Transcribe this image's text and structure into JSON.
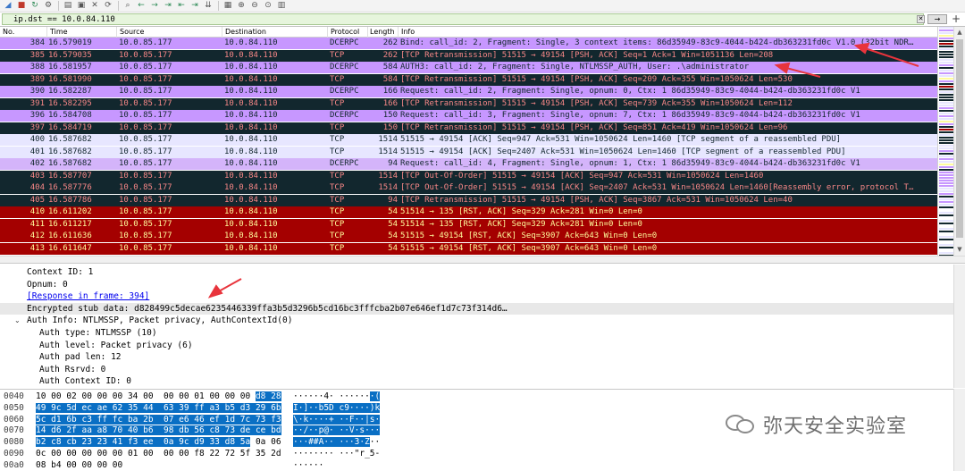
{
  "toolbar": {
    "icons": [
      "shark-fin-start-icon",
      "stop-icon",
      "restart-icon",
      "options-gear-icon",
      "open-file-icon",
      "save-file-icon",
      "close-file-icon",
      "reload-icon",
      "find-icon",
      "go-back-icon",
      "go-forward-icon",
      "jump-to-icon",
      "go-first-icon",
      "go-last-icon",
      "autoscroll-icon",
      "colorize-icon",
      "zoom-in-icon",
      "zoom-out-icon",
      "zoom-normal-icon",
      "resize-columns-icon"
    ]
  },
  "filter": {
    "value": "ip.dst == 10.0.84.110",
    "apply_label": "→"
  },
  "columns": [
    "No.",
    "Time",
    "Source",
    "Destination",
    "Protocol",
    "Length",
    "Info"
  ],
  "packets": [
    {
      "no": "384",
      "time": "16.579019",
      "src": "10.0.85.177",
      "dst": "10.0.84.110",
      "proto": "DCERPC",
      "len": "262",
      "info": "Bind: call_id: 2, Fragment: Single, 3 context items: 86d35949-83c9-4044-b424-db363231fd0c V1.0 (32bit NDR…",
      "style": "dcerpc"
    },
    {
      "no": "385",
      "time": "16.579035",
      "src": "10.0.85.177",
      "dst": "10.0.84.110",
      "proto": "TCP",
      "len": "262",
      "info": "[TCP Retransmission] 51515 → 49154 [PSH, ACK] Seq=1 Ack=1 Win=1051136 Len=208",
      "style": "tcpdark"
    },
    {
      "no": "388",
      "time": "16.581957",
      "src": "10.0.85.177",
      "dst": "10.0.84.110",
      "proto": "DCERPC",
      "len": "584",
      "info": "AUTH3: call_id: 2, Fragment: Single, NTLMSSP_AUTH, User: .\\administrator",
      "style": "dcerpc"
    },
    {
      "no": "389",
      "time": "16.581990",
      "src": "10.0.85.177",
      "dst": "10.0.84.110",
      "proto": "TCP",
      "len": "584",
      "info": "[TCP Retransmission] 51515 → 49154 [PSH, ACK] Seq=209 Ack=355 Win=1050624 Len=530",
      "style": "tcpdark"
    },
    {
      "no": "390",
      "time": "16.582287",
      "src": "10.0.85.177",
      "dst": "10.0.84.110",
      "proto": "DCERPC",
      "len": "166",
      "info": "Request: call_id: 2, Fragment: Single, opnum: 0, Ctx: 1 86d35949-83c9-4044-b424-db363231fd0c V1",
      "style": "dcerpc"
    },
    {
      "no": "391",
      "time": "16.582295",
      "src": "10.0.85.177",
      "dst": "10.0.84.110",
      "proto": "TCP",
      "len": "166",
      "info": "[TCP Retransmission] 51515 → 49154 [PSH, ACK] Seq=739 Ack=355 Win=1050624 Len=112",
      "style": "tcpdark"
    },
    {
      "no": "396",
      "time": "16.584708",
      "src": "10.0.85.177",
      "dst": "10.0.84.110",
      "proto": "DCERPC",
      "len": "150",
      "info": "Request: call_id: 3, Fragment: Single, opnum: 7, Ctx: 1 86d35949-83c9-4044-b424-db363231fd0c V1",
      "style": "dcerpc"
    },
    {
      "no": "397",
      "time": "16.584719",
      "src": "10.0.85.177",
      "dst": "10.0.84.110",
      "proto": "TCP",
      "len": "150",
      "info": "[TCP Retransmission] 51515 → 49154 [PSH, ACK] Seq=851 Ack=419 Win=1050624 Len=96",
      "style": "tcpdark"
    },
    {
      "no": "400",
      "time": "16.587682",
      "src": "10.0.85.177",
      "dst": "10.0.84.110",
      "proto": "TCP",
      "len": "1514",
      "info": "51515 → 49154 [ACK] Seq=947 Ack=531 Win=1050624 Len=1460 [TCP segment of a reassembled PDU]",
      "style": "tcplight"
    },
    {
      "no": "401",
      "time": "16.587682",
      "src": "10.0.85.177",
      "dst": "10.0.84.110",
      "proto": "TCP",
      "len": "1514",
      "info": "51515 → 49154 [ACK] Seq=2407 Ack=531 Win=1050624 Len=1460 [TCP segment of a reassembled PDU]",
      "style": "tcplight"
    },
    {
      "no": "402",
      "time": "16.587682",
      "src": "10.0.85.177",
      "dst": "10.0.84.110",
      "proto": "DCERPC",
      "len": "94",
      "info": "Request: call_id: 4, Fragment: Single, opnum: 1, Ctx: 1 86d35949-83c9-4044-b424-db363231fd0c V1",
      "style": "dcerpc-sel"
    },
    {
      "no": "403",
      "time": "16.587707",
      "src": "10.0.85.177",
      "dst": "10.0.84.110",
      "proto": "TCP",
      "len": "1514",
      "info": "[TCP Out-Of-Order] 51515 → 49154 [ACK] Seq=947 Ack=531 Win=1050624 Len=1460",
      "style": "tcpdark"
    },
    {
      "no": "404",
      "time": "16.587776",
      "src": "10.0.85.177",
      "dst": "10.0.84.110",
      "proto": "TCP",
      "len": "1514",
      "info": "[TCP Out-Of-Order] 51515 → 49154 [ACK] Seq=2407 Ack=531 Win=1050624 Len=1460[Reassembly error, protocol T…",
      "style": "tcpdark"
    },
    {
      "no": "405",
      "time": "16.587786",
      "src": "10.0.85.177",
      "dst": "10.0.84.110",
      "proto": "TCP",
      "len": "94",
      "info": "[TCP Retransmission] 51515 → 49154 [PSH, ACK] Seq=3867 Ack=531 Win=1050624 Len=40",
      "style": "tcpdark"
    },
    {
      "no": "410",
      "time": "16.611202",
      "src": "10.0.85.177",
      "dst": "10.0.84.110",
      "proto": "TCP",
      "len": "54",
      "info": "51514 → 135 [RST, ACK] Seq=329 Ack=281 Win=0 Len=0",
      "style": "rst"
    },
    {
      "no": "411",
      "time": "16.611217",
      "src": "10.0.85.177",
      "dst": "10.0.84.110",
      "proto": "TCP",
      "len": "54",
      "info": "51514 → 135 [RST, ACK] Seq=329 Ack=281 Win=0 Len=0",
      "style": "rst"
    },
    {
      "no": "412",
      "time": "16.611636",
      "src": "10.0.85.177",
      "dst": "10.0.84.110",
      "proto": "TCP",
      "len": "54",
      "info": "51515 → 49154 [RST, ACK] Seq=3907 Ack=643 Win=0 Len=0",
      "style": "rst"
    },
    {
      "no": "413",
      "time": "16.611647",
      "src": "10.0.85.177",
      "dst": "10.0.84.110",
      "proto": "TCP",
      "len": "54",
      "info": "51515 → 49154 [RST, ACK] Seq=3907 Ack=643 Win=0 Len=0",
      "style": "rst"
    }
  ],
  "details": [
    {
      "text": "Context ID: 1",
      "indent": 1,
      "kind": "plain"
    },
    {
      "text": "Opnum: 0",
      "indent": 1,
      "kind": "plain"
    },
    {
      "text": "[Response in frame: 394]",
      "indent": 1,
      "kind": "link"
    },
    {
      "text": "Encrypted stub data: d828499c5decae6235446339ffa3b5d3296b5cd16bc3fffcba2b07e646ef1d7c73f314d6…",
      "indent": 1,
      "kind": "selected"
    },
    {
      "text": "Auth Info: NTLMSSP, Packet privacy, AuthContextId(0)",
      "indent": 1,
      "kind": "expanded"
    },
    {
      "text": "Auth type: NTLMSSP (10)",
      "indent": 2,
      "kind": "plain"
    },
    {
      "text": "Auth level: Packet privacy (6)",
      "indent": 2,
      "kind": "plain"
    },
    {
      "text": "Auth pad len: 12",
      "indent": 2,
      "kind": "plain"
    },
    {
      "text": "Auth Rsrvd: 0",
      "indent": 2,
      "kind": "plain"
    },
    {
      "text": "Auth Context ID: 0",
      "indent": 2,
      "kind": "plain"
    }
  ],
  "bytes": [
    {
      "offset": "0040",
      "hex_plain": "10 00 02 00 00 00 34 00  00 00 01 00 00 00 ",
      "hex_hl": "d8 28",
      "hex_after": "",
      "ascii_plain": "······4· ······",
      "ascii_hl": "·(",
      "ascii_after": ""
    },
    {
      "offset": "0050",
      "hex_plain": "",
      "hex_hl": "49 9c 5d ec ae 62 35 44  63 39 ff a3 b5 d3 29 6b",
      "hex_after": "",
      "ascii_plain": "",
      "ascii_hl": "I·]··b5D c9····)k",
      "ascii_after": ""
    },
    {
      "offset": "0060",
      "hex_plain": "",
      "hex_hl": "5c d1 6b c3 ff fc ba 2b  07 e6 46 ef 1d 7c 73 f3",
      "hex_after": "",
      "ascii_plain": "",
      "ascii_hl": "\\·k····+ ··F··|s·",
      "ascii_after": ""
    },
    {
      "offset": "0070",
      "hex_plain": "",
      "hex_hl": "14 d6 2f aa a8 70 40 b6  98 db 56 c8 73 de ce bd",
      "hex_after": "",
      "ascii_plain": "",
      "ascii_hl": "··/··p@· ··V·s···",
      "ascii_after": ""
    },
    {
      "offset": "0080",
      "hex_plain": "",
      "hex_hl": "b2 c8 cb 23 23 41 f3 ee  0a 9c d9 33 d8 5a",
      "hex_after": " 0a 06",
      "ascii_plain": "",
      "ascii_hl": "···##A·· ···3·Z",
      "ascii_after": "··"
    },
    {
      "offset": "0090",
      "hex_plain": "0c 00 00 00 00 00 01 00  00 00 f8 22 72 5f 35 2d",
      "hex_hl": "",
      "hex_after": "",
      "ascii_plain": "········ ···\"r_5-",
      "ascii_hl": "",
      "ascii_after": ""
    },
    {
      "offset": "00a0",
      "hex_plain": "08 b4 00 00 00 00",
      "hex_hl": "",
      "hex_after": "",
      "ascii_plain": "······",
      "ascii_hl": "",
      "ascii_after": ""
    }
  ],
  "watermark": {
    "text": "弥天安全实验室"
  },
  "colors": {
    "dcerpc_bg": "#c797ff",
    "tcp_dark_bg": "#12272e",
    "tcp_dark_fg": "#f78787",
    "tcp_light_bg": "#e7e6ff",
    "rst_bg": "#a40000",
    "rst_fg": "#fffc9c",
    "annotation_arrow": "#e8343c",
    "selection_hl": "#0a6fc4"
  }
}
